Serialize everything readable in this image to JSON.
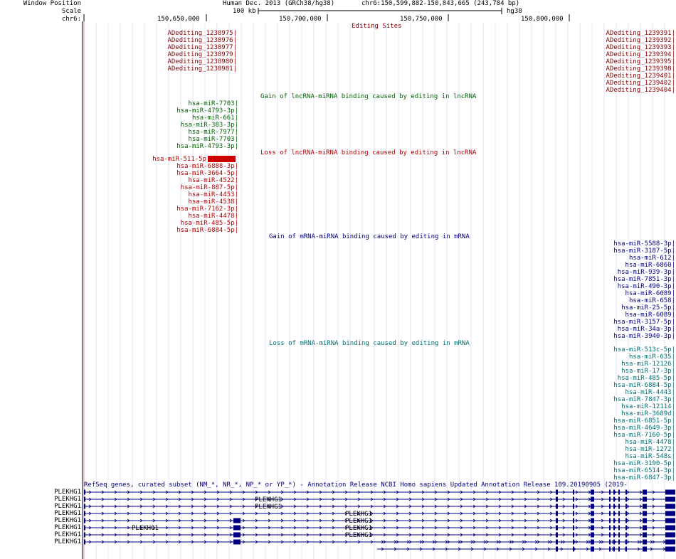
{
  "header": {
    "window_position_label": "Window Position",
    "scale_label": "Scale",
    "chrom_label": "chr6:",
    "assembly": "Human Dec. 2013 (GRCh38/hg38)",
    "position": "chr6:150,599,882-150,843,665 (243,784 bp)",
    "scale_text": "100 kb",
    "scale_assembly": "hg38",
    "ticks": [
      "150,650,000",
      "150,700,000",
      "150,750,000",
      "150,800,000"
    ]
  },
  "colors": {
    "editing": "#8b0000",
    "gain_lnc": "#006400",
    "loss_lnc": "#b40000",
    "gain_mrna": "#000080",
    "loss_mrna": "#007070",
    "genes": "#000080",
    "grid": "#e0e0ff",
    "guide": "#e8a0a0"
  },
  "editing_track": {
    "title": "Editing Sites",
    "left": [
      "ADediting_1238975",
      "ADediting_1238976",
      "ADediting_1238977",
      "ADediting_1238979",
      "ADediting_1238980",
      "ADediting_1238981"
    ],
    "right": [
      "ADediting_1239391",
      "ADediting_1239392",
      "ADediting_1239393",
      "ADediting_1239394",
      "ADediting_1239395",
      "ADediting_1239398",
      "ADediting_1239401",
      "ADediting_1239402",
      "ADediting_1239404"
    ]
  },
  "gain_lnc_track": {
    "title": "Gain of lncRNA-miRNA binding caused by editing in lncRNA",
    "items": [
      "hsa-miR-7703",
      "hsa-miR-4793-3p",
      "hsa-miR-661",
      "hsa-miR-383-3p",
      "hsa-miR-7977",
      "hsa-miR-7703",
      "hsa-miR-4793-3p"
    ]
  },
  "loss_lnc_track": {
    "title": "Loss of lncRNA-miRNA binding caused by editing in lncRNA",
    "items": [
      "hsa-miR-511-5p",
      "hsa-miR-6888-3p",
      "hsa-miR-3664-5p",
      "hsa-miR-4522",
      "hsa-miR-887-5p",
      "hsa-miR-4453",
      "hsa-miR-4538",
      "hsa-miR-7162-3p",
      "hsa-miR-4478",
      "hsa-miR-485-5p",
      "hsa-miR-6884-5p"
    ]
  },
  "gain_mrna_track": {
    "title": "Gain of mRNA-miRNA binding caused by editing in mRNA",
    "items": [
      "hsa-miR-5588-3p",
      "hsa-miR-3187-5p",
      "hsa-miR-612",
      "hsa-miR-6860",
      "hsa-miR-939-3p",
      "hsa-miR-7851-3p",
      "hsa-miR-490-3p",
      "hsa-miR-6089",
      "hsa-miR-658",
      "hsa-miR-25-5p",
      "hsa-miR-6089",
      "hsa-miR-3157-5p",
      "hsa-miR-34a-3p",
      "hsa-miR-3940-3p"
    ]
  },
  "loss_mrna_track": {
    "title": "Loss of mRNA-miRNA binding caused by editing in mRNA",
    "items": [
      "hsa-miR-513c-5p",
      "hsa-miR-635",
      "hsa-miR-12126",
      "hsa-miR-17-3p",
      "hsa-miR-485-5p",
      "hsa-miR-6884-5p",
      "hsa-miR-4443",
      "hsa-miR-7847-3p",
      "hsa-miR-12114",
      "hsa-miR-3689d",
      "hsa-miR-6851-5p",
      "hsa-miR-4649-3p",
      "hsa-miR-7160-5p",
      "hsa-miR-4478",
      "hsa-miR-1272",
      "hsa-miR-548s",
      "hsa-miR-3190-5p",
      "hsa-miR-6514-3p",
      "hsa-miR-6847-3p"
    ]
  },
  "genes_track": {
    "title": "RefSeq genes, curated subset (NM_*, NR_*, NP_* or YP_*) - Annotation Release NCBI Homo sapiens Updated Annotation Release 109.20190905 (2019-",
    "gene": "PLEKHG1",
    "row_labels": [
      "PLEKHG1",
      "PLEKHG1",
      "PLEKHG1",
      "PLEKHG1",
      "PLEKHG1",
      "PLEKHG1",
      "PLEKHG1",
      "PLEKHG1"
    ],
    "inline_labels": [
      "PLEKHG1",
      "PLEKHG1",
      "PLEKHG1",
      "PLEKHG1",
      "PLEKHG1",
      "PLEKHG1",
      "PLEKHG1"
    ]
  }
}
